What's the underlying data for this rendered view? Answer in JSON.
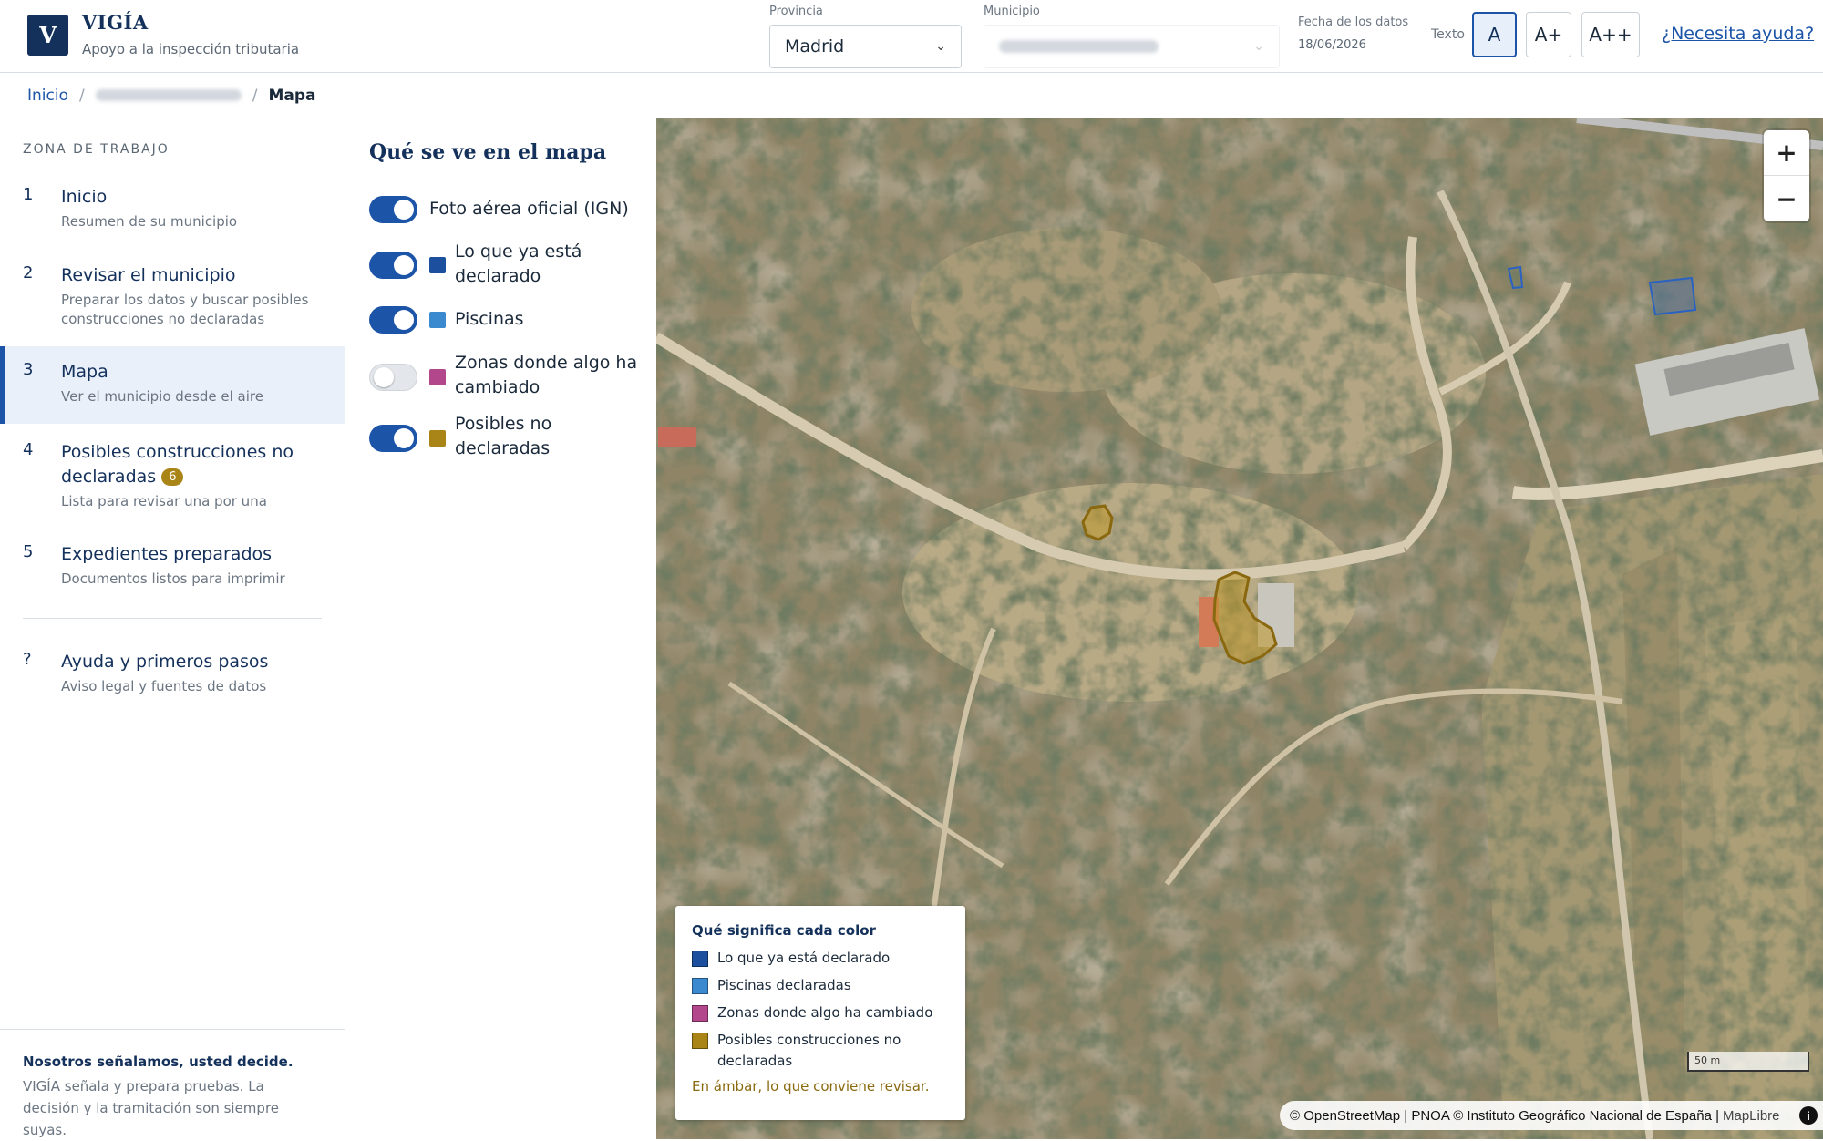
{
  "header": {
    "logo_letter": "V",
    "app_title": "VIGÍA",
    "app_subtitle": "Apoyo a la inspección tributaria",
    "provincia_label": "Provincia",
    "provincia_value": "Madrid",
    "municipio_label": "Municipio",
    "date_label": "Fecha de los datos",
    "date_value": "18/06/2026",
    "text_size_label": "Texto",
    "text_sizes": [
      "A",
      "A+",
      "A++"
    ],
    "help_link": "¿Necesita ayuda?"
  },
  "breadcrumb": {
    "home": "Inicio",
    "separator": "/",
    "current": "Mapa"
  },
  "sidebar": {
    "section_title": "ZONA DE TRABAJO",
    "items": [
      {
        "num": "1",
        "title": "Inicio",
        "desc": "Resumen de su municipio"
      },
      {
        "num": "2",
        "title": "Revisar el municipio",
        "desc": "Preparar los datos y buscar posibles construcciones no declaradas"
      },
      {
        "num": "3",
        "title": "Mapa",
        "desc": "Ver el municipio desde el aire"
      },
      {
        "num": "4",
        "title": "Posibles construcciones no declaradas",
        "badge": "6",
        "desc": "Lista para revisar una por una"
      },
      {
        "num": "5",
        "title": "Expedientes preparados",
        "desc": "Documentos listos para imprimir"
      }
    ],
    "help_item": {
      "num": "?",
      "title": "Ayuda y primeros pasos",
      "desc": "Aviso legal y fuentes de datos"
    },
    "footer_title": "Nosotros señalamos, usted decide.",
    "footer_text": "VIGÍA señala y prepara pruebas. La decisión y la tramitación son siempre suyas."
  },
  "layers_panel": {
    "title": "Qué se ve en el mapa",
    "layers": [
      {
        "label": "Foto aérea oficial (IGN)",
        "enabled": true,
        "color": ""
      },
      {
        "label": "Lo que ya está declarado",
        "enabled": true,
        "color": "#1c4f9e"
      },
      {
        "label": "Piscinas",
        "enabled": true,
        "color": "#3b8ad0"
      },
      {
        "label": "Zonas donde algo ha cambiado",
        "enabled": false,
        "color": "#b2478c"
      },
      {
        "label": "Posibles no declaradas",
        "enabled": true,
        "color": "#a98416"
      }
    ]
  },
  "map": {
    "zoom_in": "+",
    "zoom_out": "−",
    "legend": {
      "title": "Qué significa cada color",
      "items": [
        {
          "label": "Lo que ya está declarado",
          "color": "#1c4f9e"
        },
        {
          "label": "Piscinas declaradas",
          "color": "#3b8ad0"
        },
        {
          "label": "Zonas donde algo ha cambiado",
          "color": "#b2478c"
        },
        {
          "label": "Posibles construcciones no declaradas",
          "color": "#a98416"
        }
      ],
      "note": "En ámbar, lo que conviene revisar."
    },
    "scale": "50 m",
    "attribution": "© OpenStreetMap | PNOA © Instituto Geográfico Nacional de España |",
    "attribution_lib": "MapLibre",
    "info_icon": "i"
  },
  "colors": {
    "accent": "#1c54a8",
    "brand": "#14315c",
    "amber": "#a98416"
  }
}
